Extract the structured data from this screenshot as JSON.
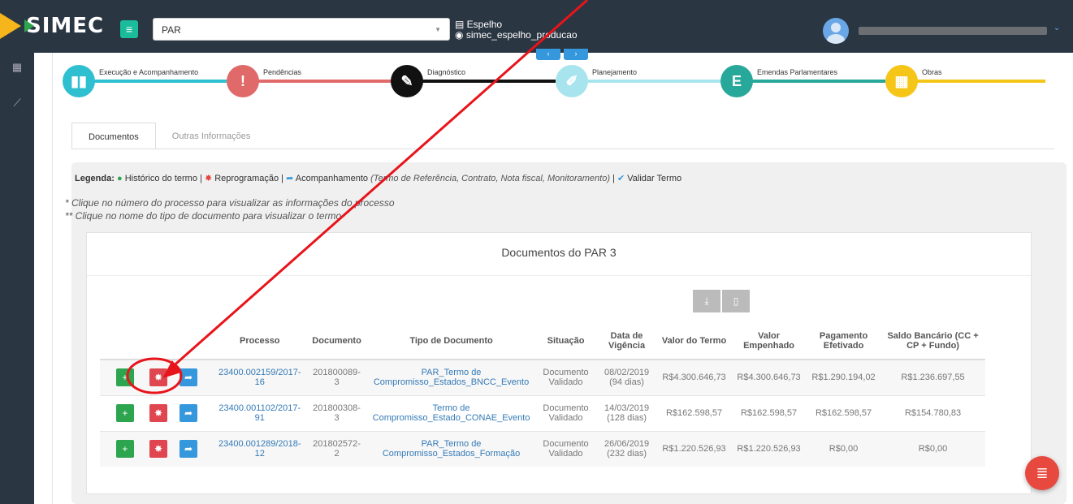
{
  "app": {
    "logo_text": "SIMEC",
    "menu_icon": "hamburger-icon"
  },
  "header": {
    "select_value": "PAR",
    "env_line1": "Espelho",
    "env_line2": "simec_espelho_producao"
  },
  "workflow": [
    {
      "label": "Execução e Acompanhamento",
      "color": "#2ec0d0",
      "icon": "chart-icon",
      "glyph": "▮▮"
    },
    {
      "label": "Pendências",
      "color": "#e06a6a",
      "icon": "warning-icon",
      "glyph": "!"
    },
    {
      "label": "Diagnóstico",
      "color": "#111111",
      "icon": "edit-icon",
      "glyph": "✎"
    },
    {
      "label": "Planejamento",
      "color": "#a8e4ee",
      "icon": "pencil-icon",
      "glyph": "✐"
    },
    {
      "label": "Emendas Parlamentares",
      "color": "#28a89a",
      "icon": "letter-e-icon",
      "glyph": "E"
    },
    {
      "label": "Obras",
      "color": "#f5c518",
      "icon": "building-icon",
      "glyph": "▦"
    }
  ],
  "tabs": [
    "Documentos",
    "Outras Informações"
  ],
  "legend": {
    "title": "Legenda:",
    "historico": "Histórico do termo",
    "reprogramacao": "Reprogramação",
    "acompanhamento": "Acompanhamento",
    "acompanhamento_note": "(Termo de Referência, Contrato, Nota fiscal, Monitoramento)",
    "validar": "Validar Termo"
  },
  "notes": [
    "* Clique no número do processo para visualizar as informações do processo",
    "** Clique no nome do tipo de documento para visualizar o termo"
  ],
  "card_title": "Documentos do PAR 3",
  "table": {
    "headers": [
      "Processo",
      "Documento",
      "Tipo de Documento",
      "Situação",
      "Data de Vigência",
      "Valor do Termo",
      "Valor Empenhado",
      "Pagamento Efetivado",
      "Saldo Bancário (CC + CP + Fundo)"
    ],
    "rows": [
      {
        "processo": "23400.002159/2017-16",
        "documento": "201800089-3",
        "tipo": "PAR_Termo de Compromisso_Estados_BNCC_Evento",
        "situacao": "Documento Validado",
        "data": "08/02/2019",
        "dias": "(94 dias)",
        "valor_termo": "R$4.300.646,73",
        "valor_empenhado": "R$4.300.646,73",
        "pagamento": "R$1.290.194,02",
        "saldo": "R$1.236.697,55"
      },
      {
        "processo": "23400.001102/2017-91",
        "documento": "201800308-3",
        "tipo": "Termo de Compromisso_Estado_CONAE_Evento",
        "situacao": "Documento Validado",
        "data": "14/03/2019",
        "dias": "(128 dias)",
        "valor_termo": "R$162.598,57",
        "valor_empenhado": "R$162.598,57",
        "pagamento": "R$162.598,57",
        "saldo": "R$154.780,83"
      },
      {
        "processo": "23400.001289/2018-12",
        "documento": "201802572-2",
        "tipo": "PAR_Termo de Compromisso_Estados_Formação",
        "situacao": "Documento Validado",
        "data": "26/06/2019",
        "dias": "(232 dias)",
        "valor_termo": "R$1.220.526,93",
        "valor_empenhado": "R$1.220.526,93",
        "pagamento": "R$0,00",
        "saldo": "R$0,00"
      }
    ]
  },
  "annotation": {
    "arrow_color": "#e8141b",
    "circle_color": "#e8141b"
  }
}
